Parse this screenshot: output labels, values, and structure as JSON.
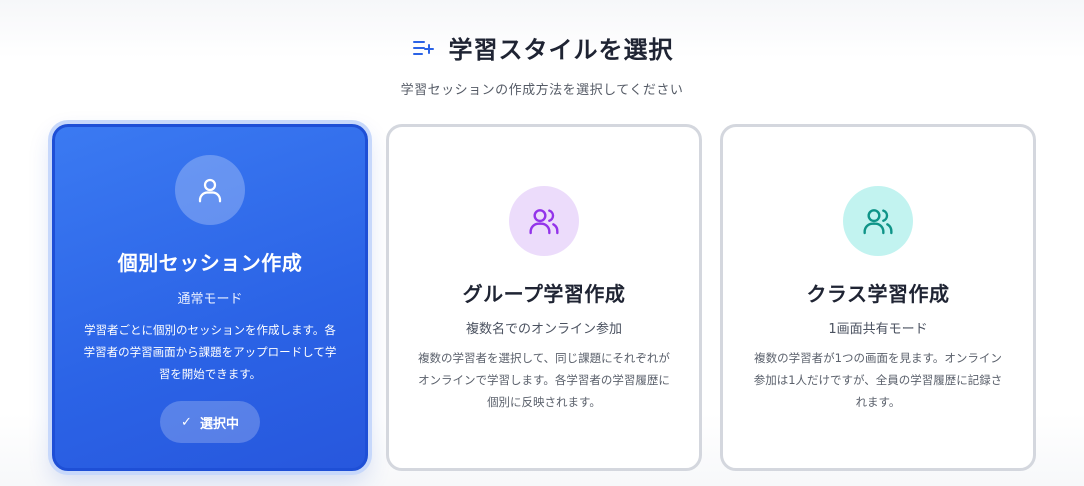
{
  "header": {
    "title": "学習スタイルを選択",
    "subtitle": "学習セッションの作成方法を選択してください",
    "icon": "list-add-icon"
  },
  "cards": [
    {
      "title": "個別セッション作成",
      "mode": "通常モード",
      "description": "学習者ごとに個別のセッションを作成します。各学習者の学習画面から課題をアップロードして学習を開始できます。",
      "icon": "user-icon",
      "selected": true,
      "badge_label": "選択中",
      "badge_check": "✓"
    },
    {
      "title": "グループ学習作成",
      "mode": "複数名でのオンライン参加",
      "description": "複数の学習者を選択して、同じ課題にそれぞれがオンラインで学習します。各学習者の学習履歴に個別に反映されます。",
      "icon": "users-icon",
      "selected": false
    },
    {
      "title": "クラス学習作成",
      "mode": "1画面共有モード",
      "description": "複数の学習者が1つの画面を見ます。オンライン参加は1人だけですが、全員の学習履歴に記録されます。",
      "icon": "users-icon",
      "selected": false
    }
  ],
  "colors": {
    "accent": "#2b63e6",
    "purple_icon": "#9333ea",
    "teal_icon": "#0f9488"
  }
}
